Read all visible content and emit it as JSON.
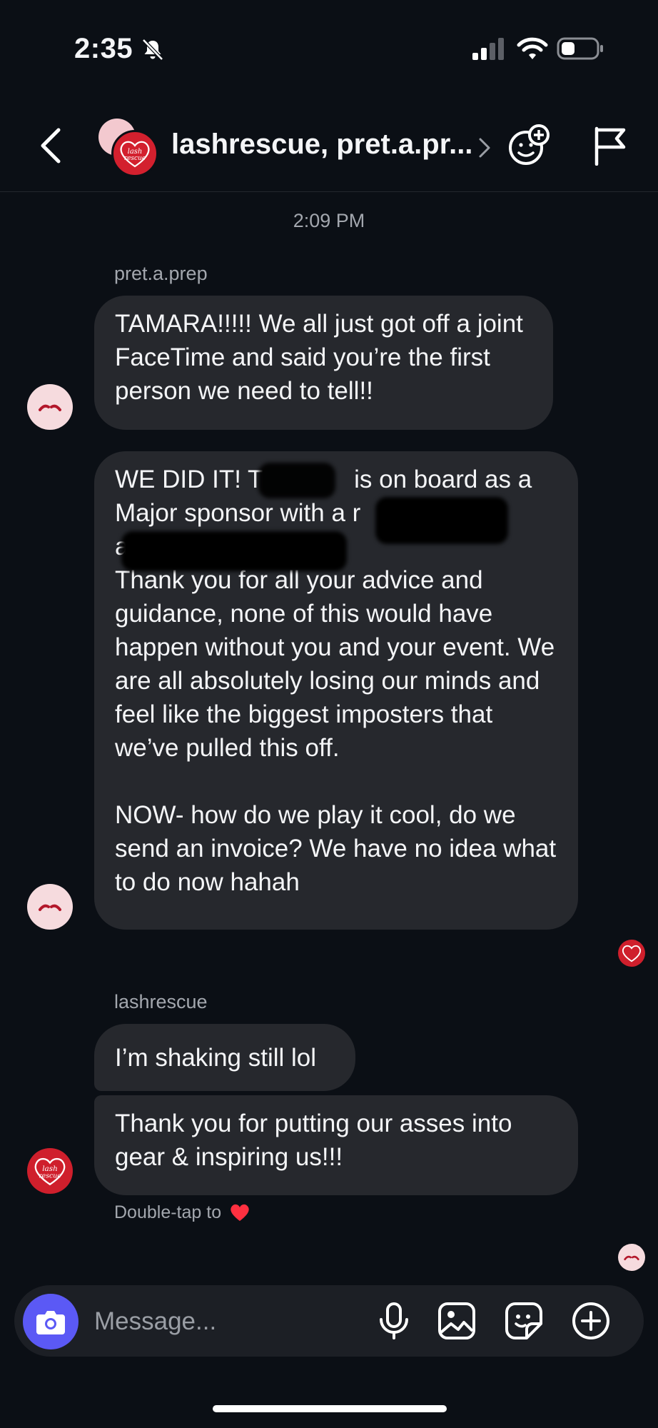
{
  "status_bar": {
    "time": "2:35"
  },
  "header": {
    "title": "lashrescue, pret.a.pr..."
  },
  "chat": {
    "timestamp": "2:09 PM",
    "group1": {
      "sender": "pret.a.prep",
      "msg1": "TAMARA!!!!! We all just got off a joint FaceTime and said you’re the first person we need to tell!!",
      "msg2": {
        "line1_a": "WE DID IT! T",
        "line1_b": "is on board as a",
        "line2": "Major sponsor with a r",
        "line3": "a",
        "paragraph": "Thank you for all your advice and guidance, none of this would have happen without you and your event. We are all absolutely losing our minds and feel like the biggest imposters that we’ve pulled this off.",
        "paragraph2": "NOW- how do we play it cool, do we send an invoice? We have no idea what to do now hahah"
      }
    },
    "group2": {
      "sender": "lashrescue",
      "msg1": "I’m shaking still lol",
      "msg2": "Thank you for putting our asses into gear & inspiring us!!!",
      "hint": "Double-tap to"
    },
    "avatar_logo_text": "lash rescue"
  },
  "composer": {
    "placeholder": "Message..."
  },
  "colors": {
    "background": "#0b0f15",
    "bubble": "#26282d",
    "camera": "#5b59f5",
    "brand_red": "#cf1f2c",
    "heart": "#ff3040"
  },
  "icons": [
    "bell-slash-icon",
    "signal-icon",
    "wifi-icon",
    "battery-icon",
    "back-arrow-icon",
    "chevron-right-icon",
    "add-face-icon",
    "flag-icon",
    "camera-icon",
    "microphone-icon",
    "gallery-icon",
    "sticker-icon",
    "plus-circle-icon",
    "heart-icon"
  ]
}
